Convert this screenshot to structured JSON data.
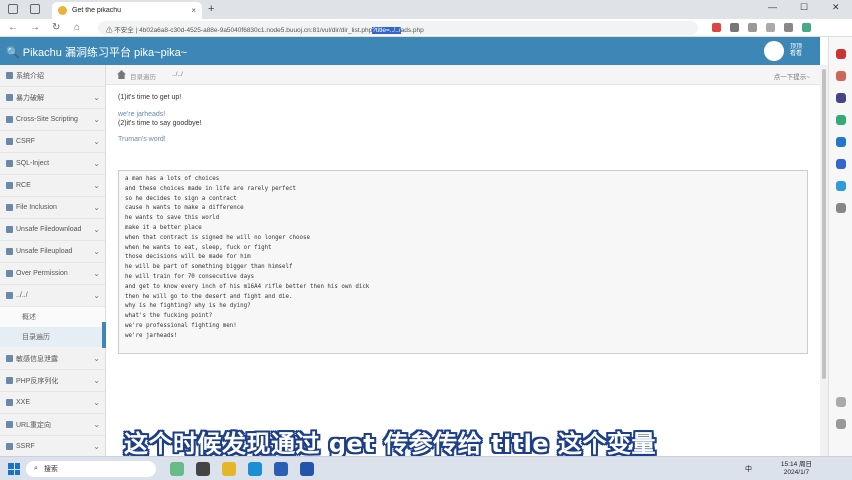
{
  "browser": {
    "tab_title": "Get the pikachu",
    "tab_close": "×",
    "new_tab": "+",
    "url_prefix": "⚠ 不安全 | ",
    "url_main": "4b02a6a8-c30d-4525-a88e-9a5040f6830c1.node5.buuoj.cn:81/vul/dir/dir_list.php",
    "url_selected": "?title=../../",
    "url_suffix": "ads.php",
    "min": "—",
    "max": "☐",
    "close": "✕"
  },
  "header": {
    "brand": "🔍 Pikachu 漏洞练习平台 pika~pika~",
    "user_line1": "顶顶",
    "user_line2": "看看"
  },
  "sidebar": {
    "items": [
      {
        "label": "系统介绍"
      },
      {
        "label": "暴力破解"
      },
      {
        "label": "Cross-Site Scripting"
      },
      {
        "label": "CSRF"
      },
      {
        "label": "SQL-Inject"
      },
      {
        "label": "RCE"
      },
      {
        "label": "File Inclusion"
      },
      {
        "label": "Unsafe Filedownload"
      },
      {
        "label": "Unsafe Fileupload"
      },
      {
        "label": "Over Permission"
      },
      {
        "label": "../../"
      }
    ],
    "sub_items": [
      {
        "label": "概述"
      },
      {
        "label": "目录遍历"
      }
    ],
    "items_after": [
      {
        "label": "敏感信息泄露"
      },
      {
        "label": "PHP反序列化"
      },
      {
        "label": "XXE"
      },
      {
        "label": "URL重定向"
      },
      {
        "label": "SSRF"
      }
    ],
    "chevron": "⌄"
  },
  "breadcrumb": {
    "first": "目录遍历",
    "second": "../../",
    "hint": "点一下提示~"
  },
  "content": {
    "line1": "(1)it's time to get up!",
    "line2": "we're jarheads!",
    "line3": "(2)it's time to say goodbye!",
    "line4": "Truman's word!",
    "poem": [
      "a man has a lots of choices",
      "and these choices made in life are rarely perfect",
      "so he decides to sign a contract",
      "cause h wants to make a difference",
      "he wants to save this world",
      "make it a better place",
      "when that contract is signed he will no longer choose",
      "when he wants to eat, sleep, fuck or fight",
      "those decisions will be made for him",
      "he will be part of something bigger than himself",
      "he will train for 70 consecutive days",
      "and get to know every inch of his m16A4 rifle better then his own dick",
      "then he will go to the desert and fight and die.",
      "why is he fighting? why is he dying?",
      "what's the fucking point?",
      "we're professional fighting men!",
      "we're jarheads!"
    ]
  },
  "subtitle": "这个时候发现通过 get 传参传给 title 这个变量",
  "taskbar": {
    "search": "搜索",
    "ime": "中",
    "time": "15:14 周日",
    "date": "2024/1/7"
  }
}
